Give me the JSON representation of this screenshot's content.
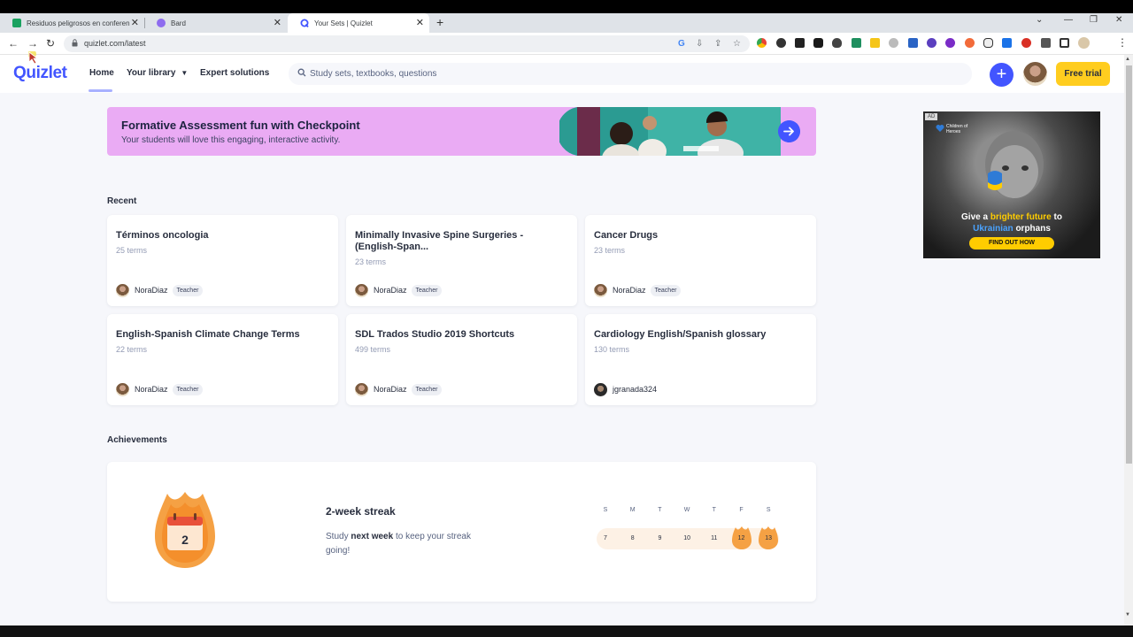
{
  "browser": {
    "tabs": [
      {
        "title": "Residuos peligrosos en conferen",
        "favicon_color": "#1aa260"
      },
      {
        "title": "Bard",
        "favicon_color": "#8e6cef"
      },
      {
        "title": "Your Sets | Quizlet",
        "favicon_color": "#4255ff"
      }
    ],
    "url": "quizlet.com/latest"
  },
  "header": {
    "logo": "Quizlet",
    "nav": {
      "home": "Home",
      "library": "Your library",
      "expert": "Expert solutions"
    },
    "search_placeholder": "Study sets, textbooks, questions",
    "free_trial": "Free trial",
    "plus": "+"
  },
  "banner": {
    "title": "Formative Assessment fun with Checkpoint",
    "subtitle": "Your students will love this engaging, interactive activity."
  },
  "recent": {
    "heading": "Recent",
    "cards": [
      {
        "title": "Términos oncologia",
        "terms": "25 terms",
        "author": "NoraDiaz",
        "badge": "Teacher"
      },
      {
        "title": "Minimally Invasive Spine Surgeries - (English-Span...",
        "terms": "23 terms",
        "author": "NoraDiaz",
        "badge": "Teacher"
      },
      {
        "title": "Cancer Drugs",
        "terms": "23 terms",
        "author": "NoraDiaz",
        "badge": "Teacher"
      },
      {
        "title": "English-Spanish Climate Change Terms",
        "terms": "22 terms",
        "author": "NoraDiaz",
        "badge": "Teacher"
      },
      {
        "title": "SDL Trados Studio 2019 Shortcuts",
        "terms": "499 terms",
        "author": "NoraDiaz",
        "badge": "Teacher"
      },
      {
        "title": "Cardiology English/Spanish glossary",
        "terms": "130 terms",
        "author": "jgranada324",
        "badge": ""
      }
    ]
  },
  "achievements": {
    "heading": "Achievements",
    "streak_count": "2",
    "streak_title": "2-week streak",
    "desc_pre": "Study ",
    "desc_bold": "next week",
    "desc_post": " to keep your streak going!",
    "days": [
      {
        "letter": "S",
        "num": "7",
        "active": false
      },
      {
        "letter": "M",
        "num": "8",
        "active": false
      },
      {
        "letter": "T",
        "num": "9",
        "active": false
      },
      {
        "letter": "W",
        "num": "10",
        "active": false
      },
      {
        "letter": "T",
        "num": "11",
        "active": false
      },
      {
        "letter": "F",
        "num": "12",
        "active": true
      },
      {
        "letter": "S",
        "num": "13",
        "active": true
      }
    ]
  },
  "ad": {
    "label": "AD",
    "brand": "Children of Heroes",
    "headline_pre": "Give a ",
    "headline_yellow": "brighter future",
    "headline_mid": " to",
    "headline_blue": "Ukrainian",
    "headline_post": " orphans",
    "cta": "FIND OUT HOW"
  },
  "colors": {
    "brand": "#4255ff",
    "free_trial": "#ffcd1f",
    "banner": "#eaabf4",
    "flame": "#f5a144"
  }
}
